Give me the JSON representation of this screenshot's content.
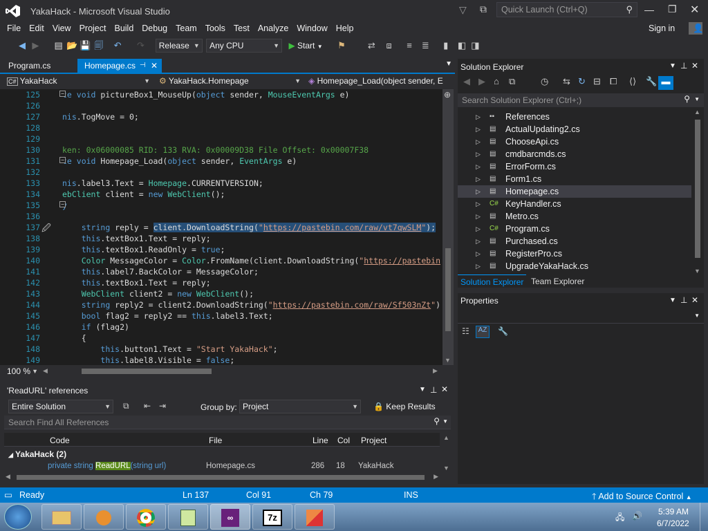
{
  "window": {
    "title": "YakaHack - Microsoft Visual Studio",
    "quick_launch": "Quick Launch (Ctrl+Q)",
    "signin": "Sign in"
  },
  "menu": [
    "File",
    "Edit",
    "View",
    "Project",
    "Build",
    "Debug",
    "Team",
    "Tools",
    "Test",
    "Analyze",
    "Window",
    "Help"
  ],
  "toolbar": {
    "config": "Release",
    "platform": "Any CPU",
    "start": "Start"
  },
  "tabs": [
    {
      "label": "Program.cs"
    },
    {
      "label": "Homepage.cs"
    }
  ],
  "navbar": {
    "project": "YakaHack",
    "class": "YakaHack.Homepage",
    "member": "Homepage_Load(object sender, E"
  },
  "editor": {
    "zoom": "100 %",
    "lines": [
      {
        "n": "125",
        "html": "<span class=\"kw\">te void</span> pictureBox1_MouseUp(<span class=\"kw\">object</span> sender, <span class=\"ty\">MouseEventArgs</span> e)"
      },
      {
        "n": "126",
        "html": ""
      },
      {
        "n": "127",
        "html": "<span class=\"kw\">nis</span>.TogMove = 0;"
      },
      {
        "n": "128",
        "html": ""
      },
      {
        "n": "129",
        "html": ""
      },
      {
        "n": "130",
        "html": "<span class=\"cm\">ken: 0x06000085 RID: 133 RVA: 0x00009D38 File Offset: 0x00007F38</span>"
      },
      {
        "n": "131",
        "html": "<span class=\"kw\">te void</span> Homepage_Load(<span class=\"kw\">object</span> sender, <span class=\"ty\">EventArgs</span> e)"
      },
      {
        "n": "132",
        "html": ""
      },
      {
        "n": "133",
        "html": "<span class=\"kw\">nis</span>.label3.Text = <span class=\"ty\">Homepage</span>.CURRENTVERSION;"
      },
      {
        "n": "134",
        "html": "<span class=\"ty\">ebClient</span> client = <span class=\"kw\">new</span> <span class=\"ty\">WebClient</span>();"
      },
      {
        "n": "135",
        "html": "<span class=\"kw\">y</span>"
      },
      {
        "n": "136",
        "html": ""
      },
      {
        "n": "137",
        "html": "    <span class=\"kw\">string</span> reply = <span style=\"background:#264f78\">client.DownloadString(<span class=\"st\">\"</span><span class=\"url\">https://pastebin.com/raw/vt7qwSLM</span><span class=\"st\">\"</span>);</span>"
      },
      {
        "n": "138",
        "html": "    <span class=\"kw\">this</span>.textBox1.Text = reply;"
      },
      {
        "n": "139",
        "html": "    <span class=\"kw\">this</span>.textBox1.ReadOnly = <span class=\"kw\">true</span>;"
      },
      {
        "n": "140",
        "html": "    <span class=\"ty\">Color</span> MessageColor = <span class=\"ty\">Color</span>.FromName(client.DownloadString(<span class=\"st\">\"</span><span class=\"url\">https://pastebin</span>"
      },
      {
        "n": "141",
        "html": "    <span class=\"kw\">this</span>.label7.BackColor = MessageColor;"
      },
      {
        "n": "142",
        "html": "    <span class=\"kw\">this</span>.textBox1.Text = reply;"
      },
      {
        "n": "143",
        "html": "    <span class=\"ty\">WebClient</span> client2 = <span class=\"kw\">new</span> <span class=\"ty\">WebClient</span>();"
      },
      {
        "n": "144",
        "html": "    <span class=\"kw\">string</span> reply2 = client2.DownloadString(<span class=\"st\">\"</span><span class=\"url\">https://pastebin.com/raw/Sf503nZt</span><span class=\"st\">\"</span>)"
      },
      {
        "n": "145",
        "html": "    <span class=\"kw\">bool</span> flag2 = reply2 == <span class=\"kw\">this</span>.label3.Text;"
      },
      {
        "n": "146",
        "html": "    <span class=\"kw\">if</span> (flag2)"
      },
      {
        "n": "147",
        "html": "    {"
      },
      {
        "n": "148",
        "html": "        <span class=\"kw\">this</span>.button1.Text = <span class=\"st\">\"Start YakaHack\"</span>;"
      },
      {
        "n": "149",
        "html": "        <span class=\"kw\">this</span>.label8.Visible = <span class=\"kw\">false</span>;"
      }
    ]
  },
  "references": {
    "title": "'ReadURL' references",
    "scope": "Entire Solution",
    "groupby_label": "Group by:",
    "groupby": "Project",
    "keep": "Keep Results",
    "search": "Search Find All References",
    "cols": [
      "Code",
      "File",
      "Line",
      "Col",
      "Project"
    ],
    "group": "YakaHack (2)",
    "row": {
      "code_pre": "private string ",
      "code_hl": "ReadURL",
      "code_post": "(string url)",
      "file": "Homepage.cs",
      "line": "286",
      "col": "18",
      "project": "YakaHack"
    }
  },
  "solution_explorer": {
    "title": "Solution Explorer",
    "search": "Search Solution Explorer (Ctrl+;)",
    "items": [
      {
        "label": "References",
        "icon": "references-icon"
      },
      {
        "label": "ActualUpdating2.cs",
        "icon": "form-icon"
      },
      {
        "label": "ChooseApi.cs",
        "icon": "form-icon"
      },
      {
        "label": "cmdbarcmds.cs",
        "icon": "form-icon"
      },
      {
        "label": "ErrorForm.cs",
        "icon": "form-icon"
      },
      {
        "label": "Form1.cs",
        "icon": "form-icon"
      },
      {
        "label": "Homepage.cs",
        "icon": "form-icon"
      },
      {
        "label": "KeyHandler.cs",
        "icon": "csharp-icon"
      },
      {
        "label": "Metro.cs",
        "icon": "form-icon"
      },
      {
        "label": "Program.cs",
        "icon": "csharp-icon"
      },
      {
        "label": "Purchased.cs",
        "icon": "form-icon"
      },
      {
        "label": "RegisterPro.cs",
        "icon": "form-icon"
      },
      {
        "label": "UpgradeYakaHack.cs",
        "icon": "form-icon"
      }
    ],
    "tab1": "Solution Explorer",
    "tab2": "Team Explorer"
  },
  "properties": {
    "title": "Properties"
  },
  "status": {
    "ready": "Ready",
    "ln": "Ln 137",
    "col": "Col 91",
    "ch": "Ch 79",
    "ins": "INS",
    "source": "Add to Source Control"
  },
  "clock": {
    "time": "5:39 AM",
    "date": "6/7/2022"
  },
  "colors": {
    "accent": "#007acc",
    "bg": "#2d2d30",
    "editor": "#1e1e1e"
  }
}
